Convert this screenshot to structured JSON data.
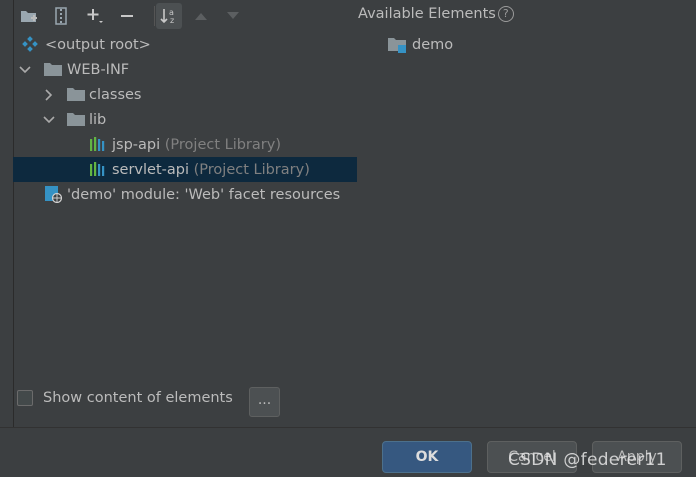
{
  "toolbar": {
    "buttons": [
      "create-directory",
      "create-archive",
      "add",
      "remove",
      "sort",
      "move-up",
      "move-down"
    ]
  },
  "tree": {
    "items": [
      {
        "label": "<output root>",
        "suffix": "",
        "icon": "output-root-icon"
      },
      {
        "label": "WEB-INF",
        "suffix": "",
        "icon": "folder-icon"
      },
      {
        "label": "classes",
        "suffix": "",
        "icon": "folder-icon"
      },
      {
        "label": "lib",
        "suffix": "",
        "icon": "folder-icon"
      },
      {
        "label": "jsp-api",
        "suffix": "(Project Library)",
        "icon": "library-icon"
      },
      {
        "label": "servlet-api",
        "suffix": "(Project Library)",
        "icon": "library-icon"
      },
      {
        "label": "'demo' module: 'Web' facet resources",
        "suffix": "",
        "icon": "web-facet-icon"
      }
    ]
  },
  "available": {
    "title": "Available Elements",
    "help": "?",
    "items": [
      {
        "label": "demo",
        "icon": "module-icon"
      }
    ]
  },
  "options": {
    "show_content_label": "Show content of elements",
    "more_label": "..."
  },
  "footer": {
    "ok": "OK",
    "cancel": "Cancel",
    "apply": "Apply",
    "watermark": "CSDN @federer11"
  },
  "colors": {
    "background": "#3c3f41",
    "selection": "#0d293e",
    "ok_button": "#365880",
    "folder": "#8a9499",
    "library_green": "#62b543",
    "library_blue": "#3592c4"
  }
}
